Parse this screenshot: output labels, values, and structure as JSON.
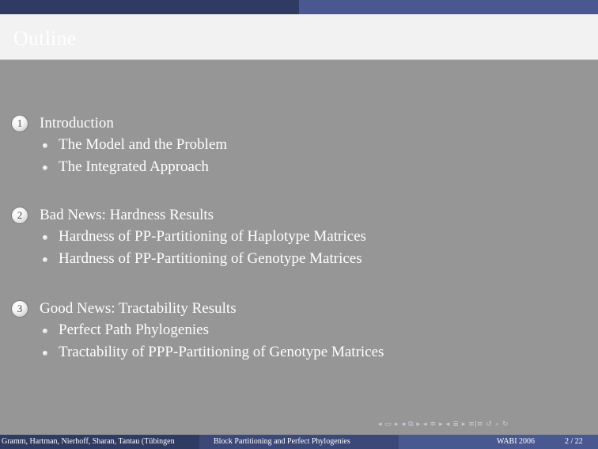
{
  "slide": {
    "title": "Outline",
    "sections": [
      {
        "number": "1",
        "title": "Introduction",
        "items": [
          "The Model and the Problem",
          "The Integrated Approach"
        ]
      },
      {
        "number": "2",
        "title": "Bad News: Hardness Results",
        "items": [
          "Hardness of PP-Partitioning of Haplotype Matrices",
          "Hardness of PP-Partitioning of Genotype Matrices"
        ]
      },
      {
        "number": "3",
        "title": "Good News: Tractability Results",
        "items": [
          "Perfect Path Phylogenies",
          "Tractability of PPP-Partitioning of Genotype Matrices"
        ]
      }
    ]
  },
  "footer": {
    "authors": "Gramm, Hartman, Nierhoff, Sharan, Tantau  (Tübingen",
    "talk_title": "Block Partitioning and Perfect Phylogenies",
    "event": "WABI 2006",
    "page": "2 / 22"
  },
  "colors": {
    "background": "#969696",
    "bar_dark": "#2f3b62",
    "bar_mid": "#3b4878",
    "bar_light": "#4a5891",
    "title_band": "#f2f2f2"
  },
  "nav_icons": [
    "arrow-left-icon",
    "frame-icon",
    "arrow-right-icon",
    "subsection-icon",
    "section-icon",
    "document-icon",
    "appendix-icon",
    "search-icon",
    "undo-icon"
  ]
}
